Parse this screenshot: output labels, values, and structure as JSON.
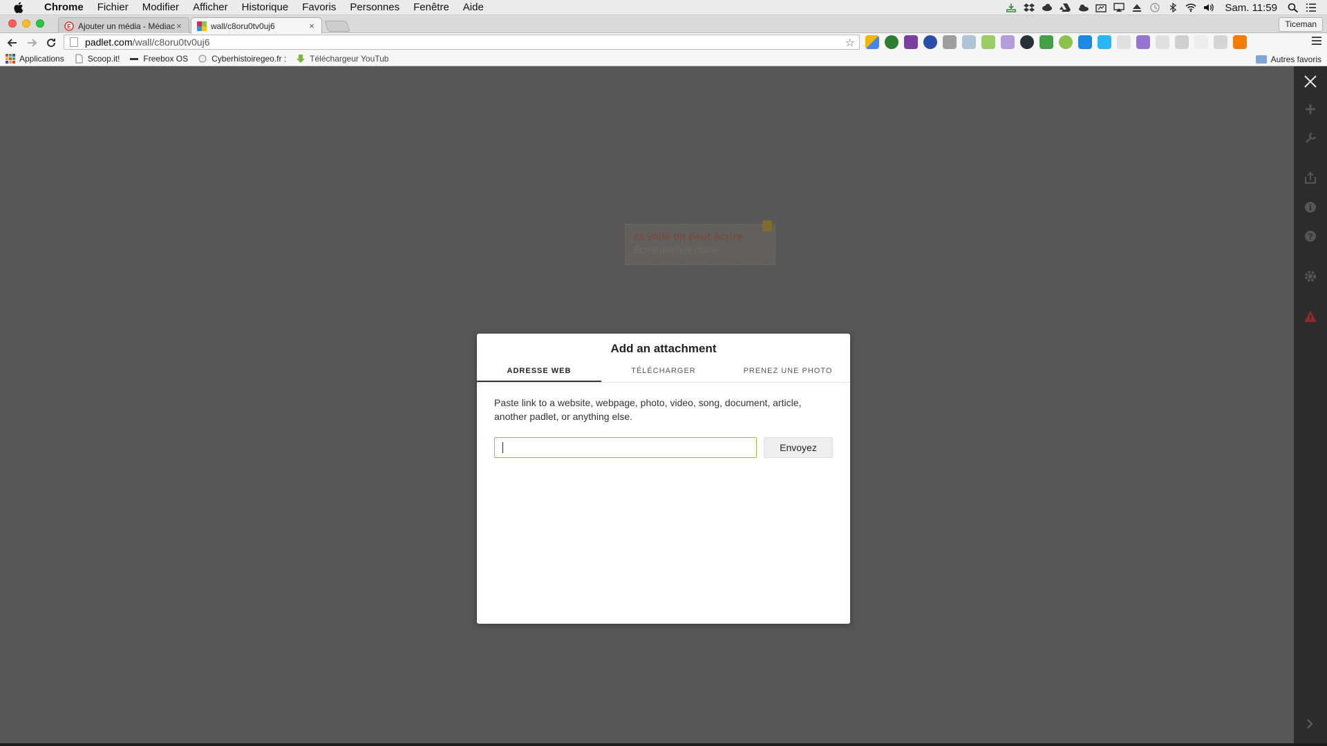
{
  "menubar": {
    "app": "Chrome",
    "items": [
      "Fichier",
      "Modifier",
      "Afficher",
      "Historique",
      "Favoris",
      "Personnes",
      "Fenêtre",
      "Aide"
    ],
    "clock": "Sam. 11:59"
  },
  "tabs": [
    {
      "title": "Ajouter un média - Médiaca",
      "active": false
    },
    {
      "title": "wall/c8oru0tv0uj6",
      "active": true
    }
  ],
  "profile": "Ticeman",
  "omnibox": {
    "host": "padlet.com",
    "path": "/wall/c8oru0tv0uj6"
  },
  "bookmarks": {
    "items": [
      "Applications",
      "Scoop.it!",
      "Freebox OS",
      "Cyberhistoiregeo.fr :",
      "Téléchargeur YouTub"
    ],
    "others": "Autres favoris"
  },
  "background_note": {
    "title": "et voilà on peut écrire",
    "placeholder": "Écrire quelque chose..."
  },
  "modal": {
    "title": "Add an attachment",
    "tabs": [
      "ADRESSE WEB",
      "TÉLÉCHARGER",
      "PRENEZ UNE PHOTO"
    ],
    "active_tab": "ADRESSE WEB",
    "help": "Paste link to a website, webpage, photo, video, song, document, article, another padlet, or anything else.",
    "input_value": "",
    "submit_label": "Envoyez"
  },
  "colors": {
    "input_border": "#8dc14c",
    "rail_bg": "#2c2c2c",
    "overlay": "#6b6b6b"
  }
}
